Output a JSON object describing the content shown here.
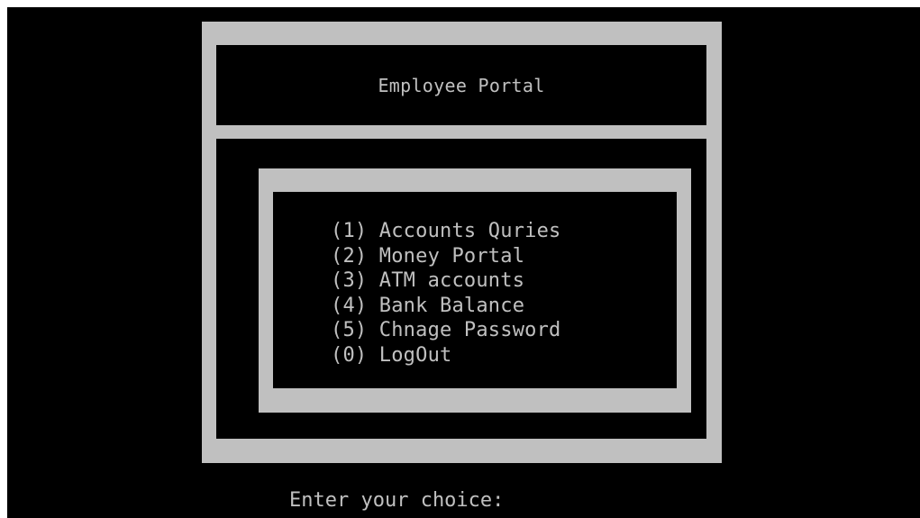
{
  "window": {
    "background": "#000000",
    "foreground": "#c0c0c0",
    "frame_color": "#c0c0c0"
  },
  "header": {
    "title": "Employee Portal"
  },
  "menu": {
    "items": [
      {
        "key": "(1)",
        "label": "Accounts Quries"
      },
      {
        "key": "(2)",
        "label": "Money Portal"
      },
      {
        "key": "(3)",
        "label": "ATM accounts"
      },
      {
        "key": "(4)",
        "label": "Bank Balance"
      },
      {
        "key": "(5)",
        "label": "Chnage Password"
      },
      {
        "key": "(0)",
        "label": "LogOut"
      }
    ]
  },
  "prompt": {
    "label": "Enter your choice:"
  }
}
